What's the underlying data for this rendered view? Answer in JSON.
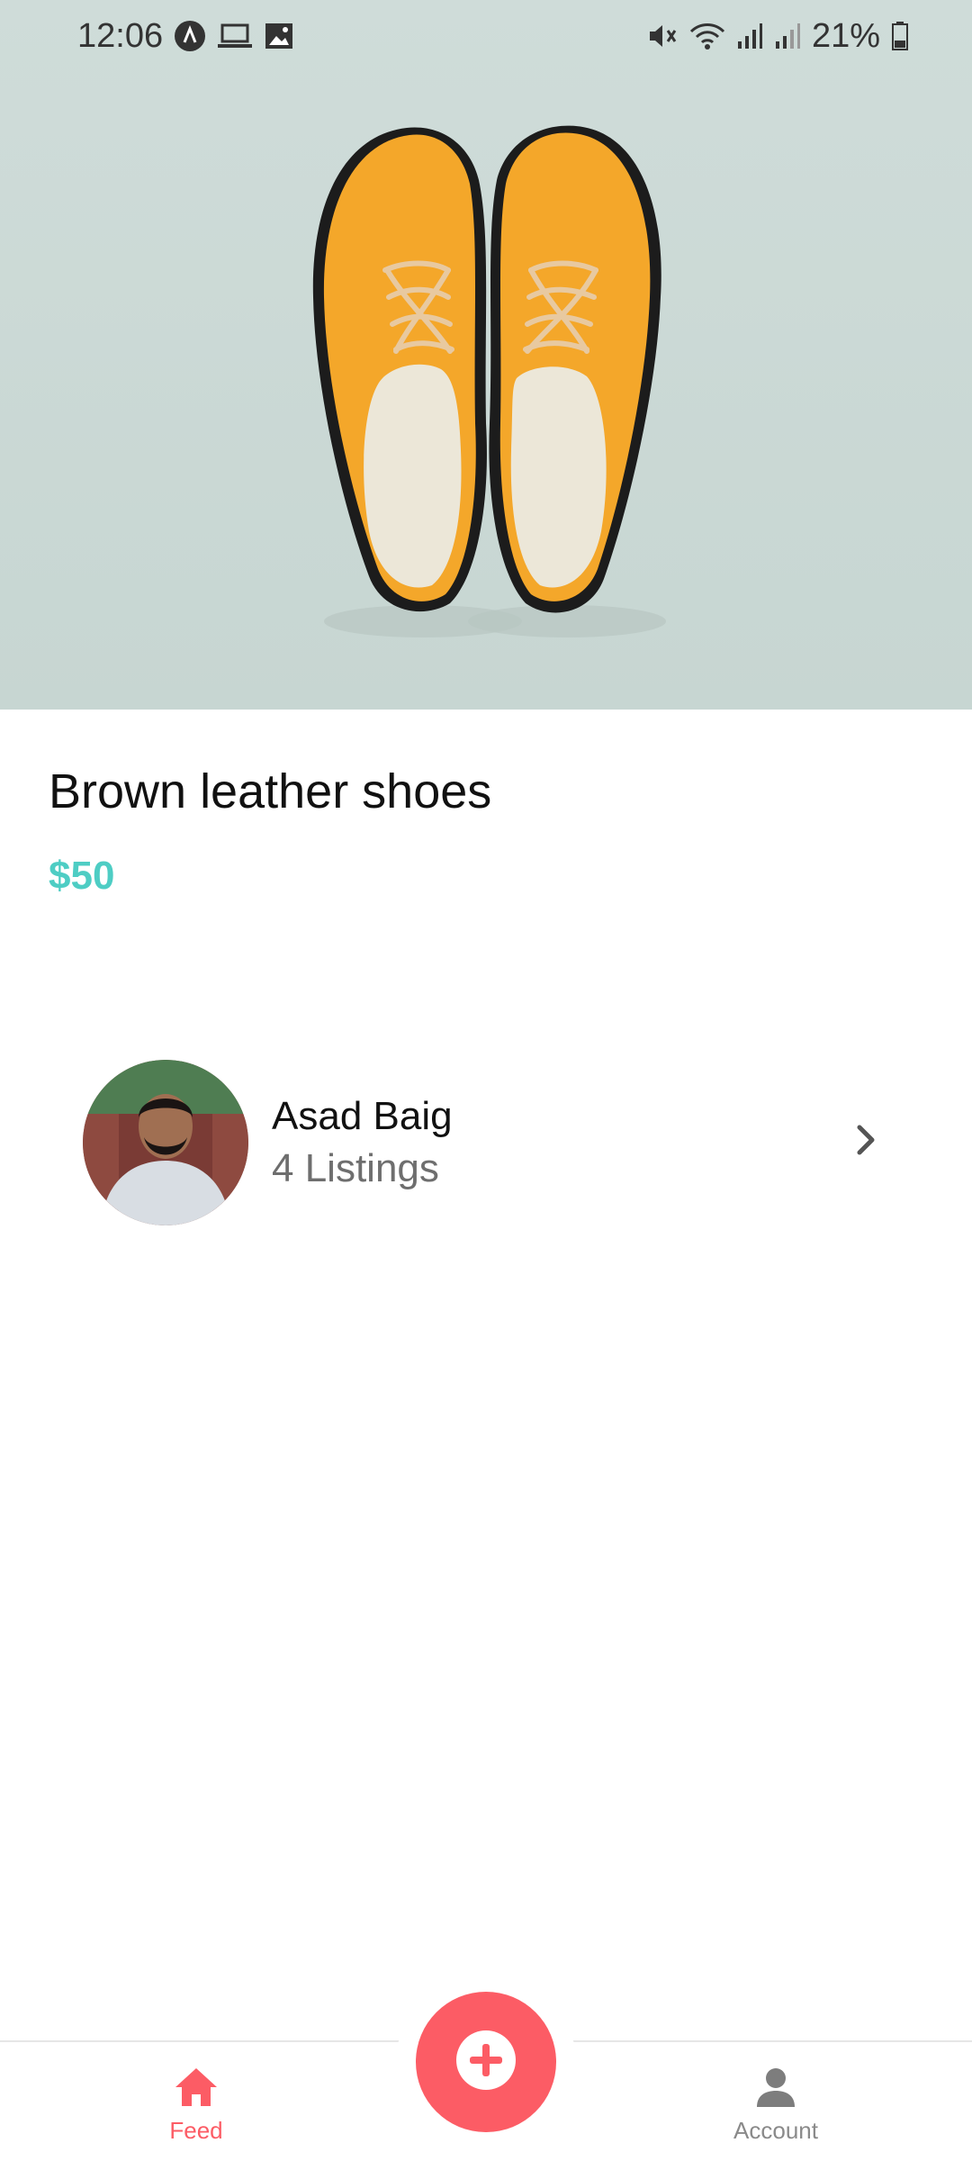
{
  "status_bar": {
    "time": "12:06",
    "battery": "21%",
    "left_icons": [
      "app-notification-icon",
      "laptop-icon",
      "image-icon"
    ],
    "right_icons": [
      "mute-icon",
      "wifi-icon",
      "signal-icon",
      "signal-icon-2",
      "battery-icon"
    ]
  },
  "product": {
    "title": "Brown leather shoes",
    "price": "$50"
  },
  "seller": {
    "name": "Asad Baig",
    "listings": "4 Listings"
  },
  "bottom_nav": {
    "feed_label": "Feed",
    "account_label": "Account"
  },
  "colors": {
    "accent": "#fc5c65",
    "price": "#4ecdc4",
    "hero_bg": "#cfdcd9",
    "shoe": "#f5a623"
  }
}
